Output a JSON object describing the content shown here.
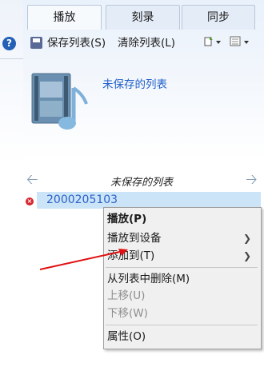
{
  "tabs": [
    "播放",
    "刻录",
    "同步"
  ],
  "toolbar": {
    "save_label": "保存列表(S)",
    "clear_label": "清除列表(L)",
    "icons": [
      "save-disk-icon",
      "list-options-icon",
      "view-options-icon"
    ]
  },
  "help_icon_text": "?",
  "playlist": {
    "header_title": "未保存的列表",
    "nav_title": "未保存的列表",
    "items": [
      {
        "name": "2000205103",
        "status": "error"
      }
    ]
  },
  "context_menu": {
    "items": [
      {
        "label": "播放(P)",
        "bold": true,
        "submenu": false,
        "disabled": false
      },
      {
        "label": "播放到设备",
        "bold": false,
        "submenu": true,
        "disabled": false
      },
      {
        "label": "添加到(T)",
        "bold": false,
        "submenu": true,
        "disabled": false
      },
      {
        "label": "从列表中删除(M)",
        "bold": false,
        "submenu": false,
        "disabled": false
      },
      {
        "label": "上移(U)",
        "bold": false,
        "submenu": false,
        "disabled": true
      },
      {
        "label": "下移(W)",
        "bold": false,
        "submenu": false,
        "disabled": true
      },
      {
        "label": "属性(O)",
        "bold": false,
        "submenu": false,
        "disabled": false
      }
    ]
  },
  "colors": {
    "accent_blue": "#1f5ec9",
    "selection": "#cce4f7",
    "error_red": "#d6262d",
    "annotation_arrow": "#e01010"
  }
}
